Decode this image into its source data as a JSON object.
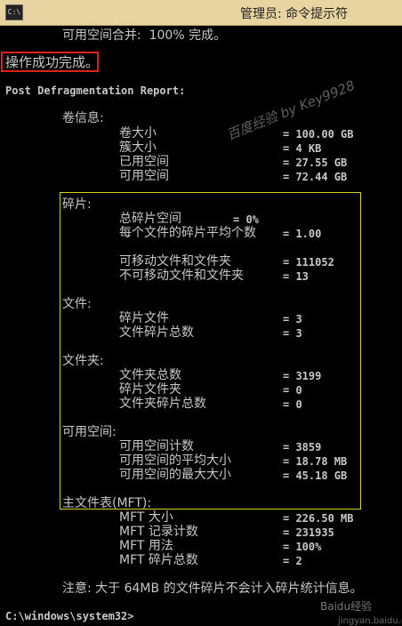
{
  "window": {
    "title": "管理员: 命令提示符",
    "icon": "console-app-icon"
  },
  "lines": {
    "merge": "可用空间合并:  100% 完成。",
    "success": "操作成功完成。",
    "report": "Post Defragmentation Report:",
    "volume_header": "卷信息:",
    "volume": {
      "size_label": "卷大小",
      "size_value": "= 100.00 GB",
      "cluster_label": "簇大小",
      "cluster_value": "= 4 KB",
      "used_label": "已用空间",
      "used_value": "= 27.55 GB",
      "free_label": "可用空间",
      "free_value": "= 72.44 GB"
    },
    "frag_header": "碎片:",
    "frag": {
      "total_label": "总碎片空间",
      "total_value": "= 0%",
      "avg_label": "每个文件的碎片平均个数",
      "avg_value": "= 1.00",
      "movable_label": "可移动文件和文件夹",
      "movable_value": "= 111052",
      "unmovable_label": "不可移动文件和文件夹",
      "unmovable_value": "= 13"
    },
    "files_header": "文件:",
    "files": {
      "frag_files_label": "碎片文件",
      "frag_files_value": "= 3",
      "total_frags_label": "文件碎片总数",
      "total_frags_value": "= 3"
    },
    "folders_header": "文件夹:",
    "folders": {
      "total_label": "文件夹总数",
      "total_value": "= 3199",
      "frag_label": "碎片文件夹",
      "frag_value": "= 0",
      "frag_total_label": "文件夹碎片总数",
      "frag_total_value": "= 0"
    },
    "free_header": "可用空间:",
    "free": {
      "count_label": "可用空间计数",
      "count_value": "= 3859",
      "avg_label": "可用空间的平均大小",
      "avg_value": "= 18.78 MB",
      "max_label": "可用空间的最大大小",
      "max_value": "= 45.18 GB"
    },
    "mft_header": "主文件表(MFT):",
    "mft": {
      "size_label": "MFT 大小",
      "size_value": "= 226.50 MB",
      "records_label": "MFT 记录计数",
      "records_value": "= 231935",
      "usage_label": "MFT 用法",
      "usage_value": "= 100%",
      "frags_label": "MFT 碎片总数",
      "frags_value": "= 2"
    },
    "note": "注意: 大于 64MB 的文件碎片不会计入碎片统计信息。",
    "prompt": "C:\\windows\\system32>"
  },
  "watermarks": {
    "exp": "百度经验 by Key9928",
    "site": "jingyan.baidu.com",
    "logo": "Baidu经验"
  },
  "colors": {
    "text": "#c8c8c8",
    "highlight_red": "#e0201c",
    "highlight_yellow": "#d8d020",
    "titlebar": "#e8d4a0"
  }
}
